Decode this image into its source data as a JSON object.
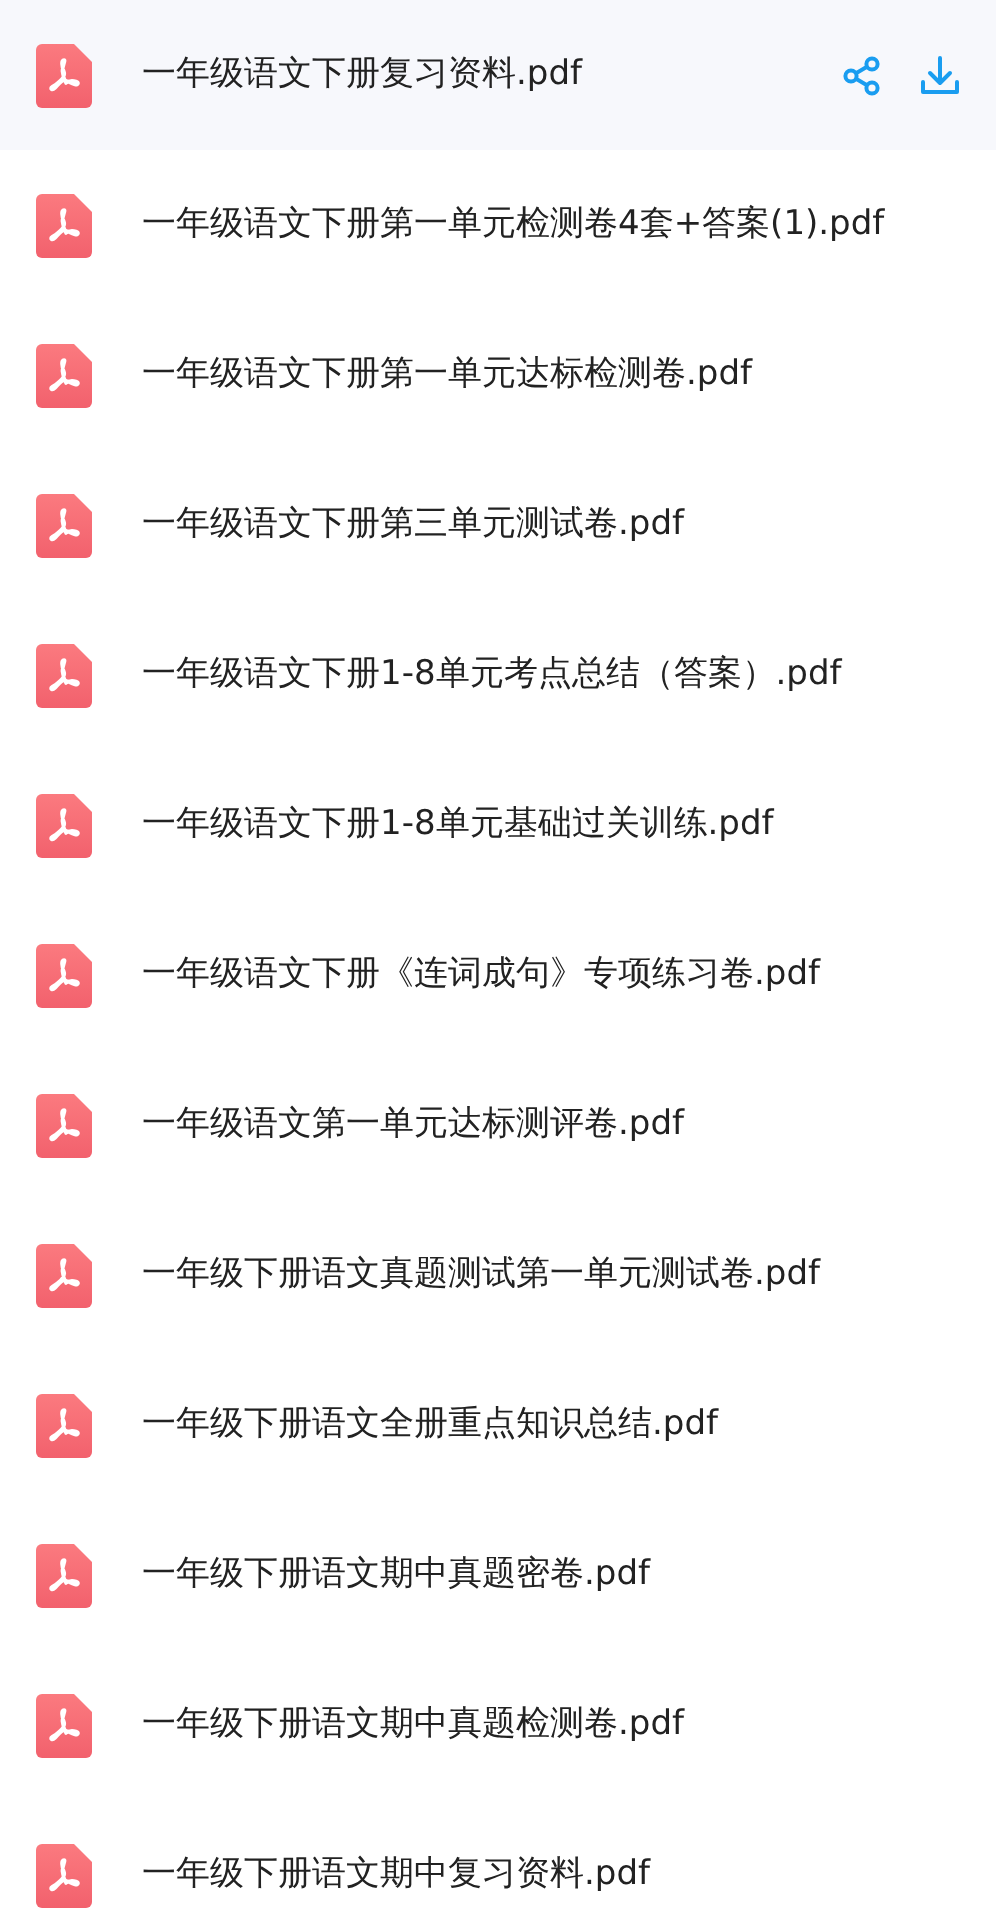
{
  "files": [
    {
      "name": "一年级语文下册复习资料.pdf",
      "selected": true
    },
    {
      "name": "一年级语文下册第一单元检测卷4套+答案(1).pdf",
      "selected": false
    },
    {
      "name": "一年级语文下册第一单元达标检测卷.pdf",
      "selected": false
    },
    {
      "name": "一年级语文下册第三单元测试卷.pdf",
      "selected": false
    },
    {
      "name": "一年级语文下册1-8单元考点总结（答案）.pdf",
      "selected": false
    },
    {
      "name": "一年级语文下册1-8单元基础过关训练.pdf",
      "selected": false
    },
    {
      "name": "一年级语文下册《连词成句》专项练习卷.pdf",
      "selected": false
    },
    {
      "name": "一年级语文第一单元达标测评卷.pdf",
      "selected": false
    },
    {
      "name": "一年级下册语文真题测试第一单元测试卷.pdf",
      "selected": false
    },
    {
      "name": "一年级下册语文全册重点知识总结.pdf",
      "selected": false
    },
    {
      "name": "一年级下册语文期中真题密卷.pdf",
      "selected": false
    },
    {
      "name": "一年级下册语文期中真题检测卷.pdf",
      "selected": false
    },
    {
      "name": "一年级下册语文期中复习资料.pdf",
      "selected": false
    }
  ]
}
